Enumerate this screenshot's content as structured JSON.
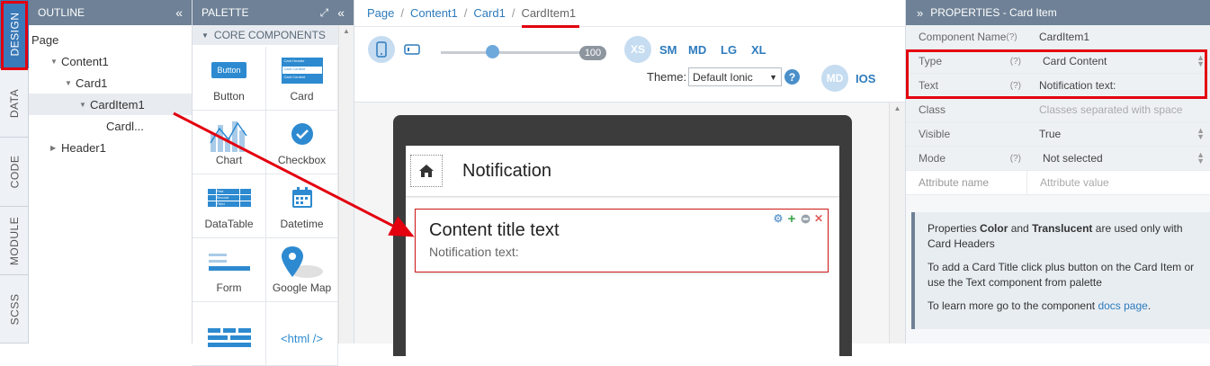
{
  "tabs": [
    "DESIGN",
    "DATA",
    "CODE",
    "MODULE",
    "SCSS"
  ],
  "outline": {
    "title": "OUTLINE",
    "tree": [
      "Page",
      "Content1",
      "Card1",
      "CardItem1",
      "Cardl...",
      "Header1"
    ]
  },
  "palette": {
    "title": "PALETTE",
    "section": "CORE COMPONENTS",
    "items": [
      {
        "label": "Button",
        "icon": "button-icon"
      },
      {
        "label": "Card",
        "icon": "card-icon"
      },
      {
        "label": "Chart",
        "icon": "chart-icon"
      },
      {
        "label": "Checkbox",
        "icon": "checkbox-icon"
      },
      {
        "label": "DataTable",
        "icon": "datatable-icon"
      },
      {
        "label": "Datetime",
        "icon": "calendar-icon"
      },
      {
        "label": "Form",
        "icon": "form-icon"
      },
      {
        "label": "Google Map",
        "icon": "map-pin-icon"
      },
      {
        "label": "",
        "icon": "grid-icon"
      },
      {
        "label": "<html />",
        "icon": "html-icon"
      }
    ],
    "button_icon_text": "Button",
    "datatable_rows": [
      "First",
      "Second",
      "Third"
    ],
    "card_rows": [
      "Card Header",
      "Card Content",
      "Card Content"
    ]
  },
  "breadcrumb": [
    "Page",
    "Content1",
    "Card1",
    "CardItem1"
  ],
  "toolbar": {
    "slider_value": "100",
    "breakpoints": [
      "XS",
      "SM",
      "MD",
      "LG",
      "XL"
    ],
    "theme_label": "Theme:",
    "theme_value": "Default Ionic",
    "help": "?",
    "platforms": [
      "MD",
      "IOS"
    ]
  },
  "preview": {
    "header_title": "Notification",
    "card_title": "Content title text",
    "card_text": "Notification text:"
  },
  "properties": {
    "title": "PROPERTIES - Card Item",
    "rows": [
      {
        "name": "Component Name",
        "hint": "(?)",
        "value": "CardItem1"
      },
      {
        "name": "Type",
        "hint": "(?)",
        "value": "Card Content"
      },
      {
        "name": "Text",
        "hint": "(?)",
        "value": "Notification text:"
      },
      {
        "name": "Class",
        "hint": "",
        "value": "Classes separated with space"
      },
      {
        "name": "Visible",
        "hint": "",
        "value": "True"
      },
      {
        "name": "Mode",
        "hint": "(?)",
        "value": "Not selected"
      },
      {
        "name": "Attribute name",
        "hint": "",
        "value": "Attribute value"
      }
    ],
    "info": {
      "p1_a": "Properties ",
      "p1_b": "Color",
      "p1_c": " and ",
      "p1_d": "Translucent",
      "p1_e": " are used only with Card Headers",
      "p2": "To add a Card Title click plus button on the Card Item or use the Text component from palette",
      "p3_a": "To learn more go to the component ",
      "p3_link": "docs page",
      "p3_b": "."
    }
  },
  "colors": {
    "accent": "#2d7bbd",
    "header": "#6e8196",
    "highlight": "#e3000f"
  }
}
